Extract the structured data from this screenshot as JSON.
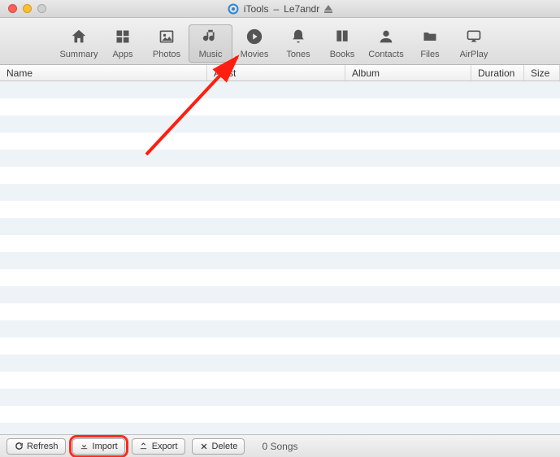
{
  "window": {
    "app_name": "iTools",
    "device_name": "Le7andr"
  },
  "toolbar": {
    "items": [
      {
        "id": "summary",
        "label": "Summary",
        "icon": "home-icon",
        "selected": false
      },
      {
        "id": "apps",
        "label": "Apps",
        "icon": "grid-icon",
        "selected": false
      },
      {
        "id": "photos",
        "label": "Photos",
        "icon": "image-icon",
        "selected": false
      },
      {
        "id": "music",
        "label": "Music",
        "icon": "music-icon",
        "selected": true
      },
      {
        "id": "movies",
        "label": "Movies",
        "icon": "play-icon",
        "selected": false
      },
      {
        "id": "tones",
        "label": "Tones",
        "icon": "bell-icon",
        "selected": false
      },
      {
        "id": "books",
        "label": "Books",
        "icon": "book-icon",
        "selected": false
      },
      {
        "id": "contacts",
        "label": "Contacts",
        "icon": "contact-icon",
        "selected": false
      },
      {
        "id": "files",
        "label": "Files",
        "icon": "folder-icon",
        "selected": false
      },
      {
        "id": "airplay",
        "label": "AirPlay",
        "icon": "airplay-icon",
        "selected": false
      }
    ]
  },
  "columns": {
    "name": "Name",
    "artist": "Artist",
    "album": "Album",
    "duration": "Duration",
    "size": "Size"
  },
  "bottom": {
    "refresh": "Refresh",
    "import": "Import",
    "export": "Export",
    "delete": "Delete",
    "status": "0 Songs"
  },
  "list": {
    "rows": []
  }
}
